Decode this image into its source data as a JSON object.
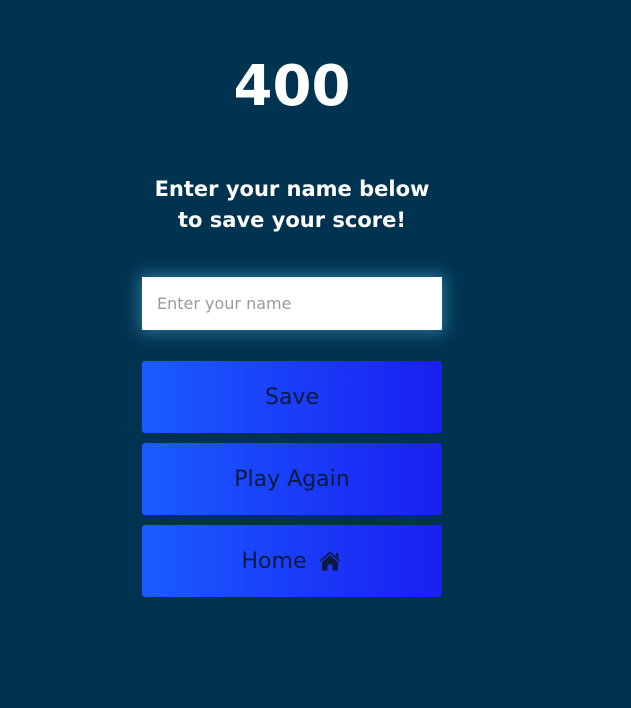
{
  "score": {
    "value": "400"
  },
  "prompt": {
    "text": "Enter your name below to save your score!"
  },
  "name_input": {
    "placeholder": "Enter your name",
    "value": ""
  },
  "buttons": {
    "save_label": "Save",
    "play_again_label": "Play Again",
    "home_label": "Home",
    "home_icon": "home-icon"
  },
  "colors": {
    "background": "#003350",
    "button_gradient_start": "#1a5cff",
    "button_gradient_end": "#1a1ff2",
    "button_text": "#0b1a3e",
    "input_glow": "#56b9eb"
  }
}
